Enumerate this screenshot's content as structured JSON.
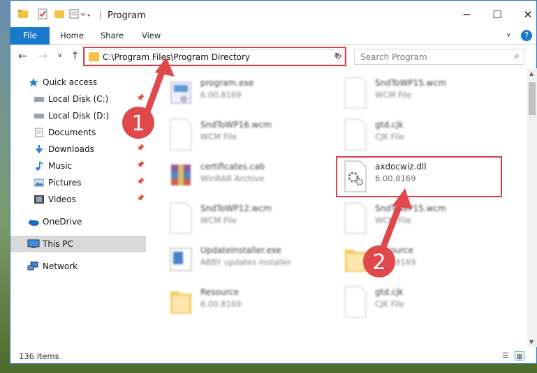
{
  "window": {
    "title": "Program"
  },
  "ribbon": {
    "tabs": [
      "File",
      "Home",
      "Share",
      "View"
    ],
    "help": "?"
  },
  "nav": {
    "back": "←",
    "forward": "→",
    "recent": "∨",
    "up": "↑"
  },
  "address": {
    "path": "C:\\Program Files\\Program Directory",
    "refresh": "↻"
  },
  "search": {
    "placeholder": "Search Program"
  },
  "sidebar": {
    "items": [
      {
        "label": "Quick access",
        "icon": "star-icon",
        "pinned": false
      },
      {
        "label": "Local Disk (C:)",
        "icon": "drive-icon",
        "pinned": true
      },
      {
        "label": "Local Disk (D:)",
        "icon": "drive-icon",
        "pinned": false
      },
      {
        "label": "Documents",
        "icon": "documents-icon",
        "pinned": true
      },
      {
        "label": "Downloads",
        "icon": "download-icon",
        "pinned": true
      },
      {
        "label": "Music",
        "icon": "music-icon",
        "pinned": true
      },
      {
        "label": "Pictures",
        "icon": "pictures-icon",
        "pinned": true
      },
      {
        "label": "Videos",
        "icon": "videos-icon",
        "pinned": true
      },
      {
        "label": "OneDrive",
        "icon": "onedrive-icon",
        "pinned": false
      },
      {
        "label": "This PC",
        "icon": "computer-icon",
        "pinned": false
      },
      {
        "label": "Network",
        "icon": "network-icon",
        "pinned": false
      }
    ]
  },
  "files": [
    {
      "name": "program.exe",
      "sub": "6.00.8169",
      "icon": "exe-icon"
    },
    {
      "name": "SndToWP15.wcm",
      "sub": "WCM File",
      "icon": "document-icon"
    },
    {
      "name": "SndToWP16.wcm",
      "sub": "WCM File",
      "icon": "document-icon"
    },
    {
      "name": "gtd.cjk",
      "sub": "CJK File",
      "icon": "document-icon"
    },
    {
      "name": "certificates.cab",
      "sub": "WinRAR Archive",
      "icon": "winrar-icon"
    },
    {
      "name": "axdocwiz.dll",
      "sub": "6.00.8169",
      "icon": "dll-gear-icon"
    },
    {
      "name": "SndToWP12.wcm",
      "sub": "WCM File",
      "icon": "document-icon"
    },
    {
      "name": "SndToWP15.wcm",
      "sub": "WCM File",
      "icon": "document-icon"
    },
    {
      "name": "UpdateInstaller.exe",
      "sub": "ABBY updates installer",
      "icon": "installer-icon"
    },
    {
      "name": "Resource",
      "sub": "6.00.8169",
      "icon": "folder-icon"
    },
    {
      "name": "Resource",
      "sub": "6.00.8169",
      "icon": "folder-icon"
    },
    {
      "name": "gtd.cjk",
      "sub": "CJK File",
      "icon": "document-icon"
    }
  ],
  "status": {
    "items": "136 items"
  },
  "markers": [
    "1",
    "2"
  ],
  "colors": {
    "accent": "#1979ca",
    "highlight": "#d9434a",
    "folder": "#f5c242"
  }
}
